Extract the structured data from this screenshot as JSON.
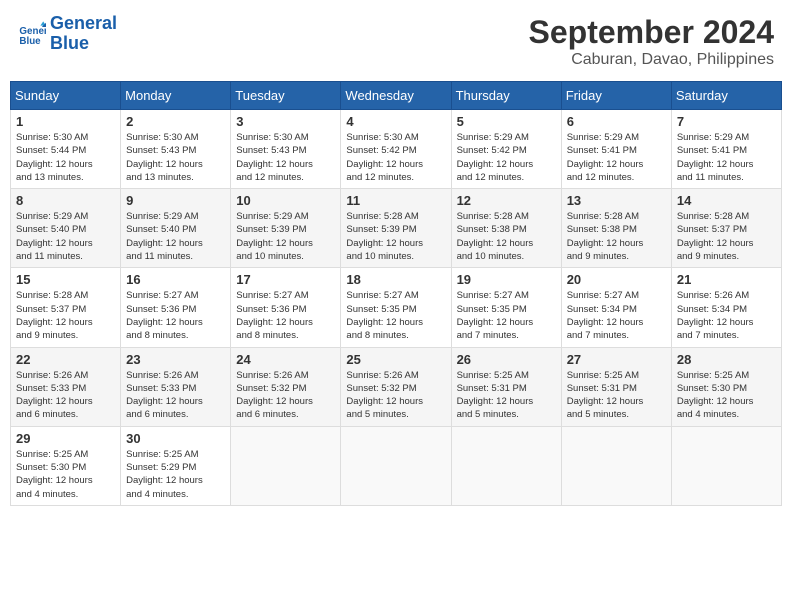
{
  "header": {
    "logo_line1": "General",
    "logo_line2": "Blue",
    "month": "September 2024",
    "location": "Caburan, Davao, Philippines"
  },
  "days_of_week": [
    "Sunday",
    "Monday",
    "Tuesday",
    "Wednesday",
    "Thursday",
    "Friday",
    "Saturday"
  ],
  "weeks": [
    [
      {
        "day": "1",
        "info": "Sunrise: 5:30 AM\nSunset: 5:44 PM\nDaylight: 12 hours\nand 13 minutes."
      },
      {
        "day": "2",
        "info": "Sunrise: 5:30 AM\nSunset: 5:43 PM\nDaylight: 12 hours\nand 13 minutes."
      },
      {
        "day": "3",
        "info": "Sunrise: 5:30 AM\nSunset: 5:43 PM\nDaylight: 12 hours\nand 12 minutes."
      },
      {
        "day": "4",
        "info": "Sunrise: 5:30 AM\nSunset: 5:42 PM\nDaylight: 12 hours\nand 12 minutes."
      },
      {
        "day": "5",
        "info": "Sunrise: 5:29 AM\nSunset: 5:42 PM\nDaylight: 12 hours\nand 12 minutes."
      },
      {
        "day": "6",
        "info": "Sunrise: 5:29 AM\nSunset: 5:41 PM\nDaylight: 12 hours\nand 12 minutes."
      },
      {
        "day": "7",
        "info": "Sunrise: 5:29 AM\nSunset: 5:41 PM\nDaylight: 12 hours\nand 11 minutes."
      }
    ],
    [
      {
        "day": "8",
        "info": "Sunrise: 5:29 AM\nSunset: 5:40 PM\nDaylight: 12 hours\nand 11 minutes."
      },
      {
        "day": "9",
        "info": "Sunrise: 5:29 AM\nSunset: 5:40 PM\nDaylight: 12 hours\nand 11 minutes."
      },
      {
        "day": "10",
        "info": "Sunrise: 5:29 AM\nSunset: 5:39 PM\nDaylight: 12 hours\nand 10 minutes."
      },
      {
        "day": "11",
        "info": "Sunrise: 5:28 AM\nSunset: 5:39 PM\nDaylight: 12 hours\nand 10 minutes."
      },
      {
        "day": "12",
        "info": "Sunrise: 5:28 AM\nSunset: 5:38 PM\nDaylight: 12 hours\nand 10 minutes."
      },
      {
        "day": "13",
        "info": "Sunrise: 5:28 AM\nSunset: 5:38 PM\nDaylight: 12 hours\nand 9 minutes."
      },
      {
        "day": "14",
        "info": "Sunrise: 5:28 AM\nSunset: 5:37 PM\nDaylight: 12 hours\nand 9 minutes."
      }
    ],
    [
      {
        "day": "15",
        "info": "Sunrise: 5:28 AM\nSunset: 5:37 PM\nDaylight: 12 hours\nand 9 minutes."
      },
      {
        "day": "16",
        "info": "Sunrise: 5:27 AM\nSunset: 5:36 PM\nDaylight: 12 hours\nand 8 minutes."
      },
      {
        "day": "17",
        "info": "Sunrise: 5:27 AM\nSunset: 5:36 PM\nDaylight: 12 hours\nand 8 minutes."
      },
      {
        "day": "18",
        "info": "Sunrise: 5:27 AM\nSunset: 5:35 PM\nDaylight: 12 hours\nand 8 minutes."
      },
      {
        "day": "19",
        "info": "Sunrise: 5:27 AM\nSunset: 5:35 PM\nDaylight: 12 hours\nand 7 minutes."
      },
      {
        "day": "20",
        "info": "Sunrise: 5:27 AM\nSunset: 5:34 PM\nDaylight: 12 hours\nand 7 minutes."
      },
      {
        "day": "21",
        "info": "Sunrise: 5:26 AM\nSunset: 5:34 PM\nDaylight: 12 hours\nand 7 minutes."
      }
    ],
    [
      {
        "day": "22",
        "info": "Sunrise: 5:26 AM\nSunset: 5:33 PM\nDaylight: 12 hours\nand 6 minutes."
      },
      {
        "day": "23",
        "info": "Sunrise: 5:26 AM\nSunset: 5:33 PM\nDaylight: 12 hours\nand 6 minutes."
      },
      {
        "day": "24",
        "info": "Sunrise: 5:26 AM\nSunset: 5:32 PM\nDaylight: 12 hours\nand 6 minutes."
      },
      {
        "day": "25",
        "info": "Sunrise: 5:26 AM\nSunset: 5:32 PM\nDaylight: 12 hours\nand 5 minutes."
      },
      {
        "day": "26",
        "info": "Sunrise: 5:25 AM\nSunset: 5:31 PM\nDaylight: 12 hours\nand 5 minutes."
      },
      {
        "day": "27",
        "info": "Sunrise: 5:25 AM\nSunset: 5:31 PM\nDaylight: 12 hours\nand 5 minutes."
      },
      {
        "day": "28",
        "info": "Sunrise: 5:25 AM\nSunset: 5:30 PM\nDaylight: 12 hours\nand 4 minutes."
      }
    ],
    [
      {
        "day": "29",
        "info": "Sunrise: 5:25 AM\nSunset: 5:30 PM\nDaylight: 12 hours\nand 4 minutes."
      },
      {
        "day": "30",
        "info": "Sunrise: 5:25 AM\nSunset: 5:29 PM\nDaylight: 12 hours\nand 4 minutes."
      },
      {
        "day": "",
        "info": ""
      },
      {
        "day": "",
        "info": ""
      },
      {
        "day": "",
        "info": ""
      },
      {
        "day": "",
        "info": ""
      },
      {
        "day": "",
        "info": ""
      }
    ]
  ]
}
